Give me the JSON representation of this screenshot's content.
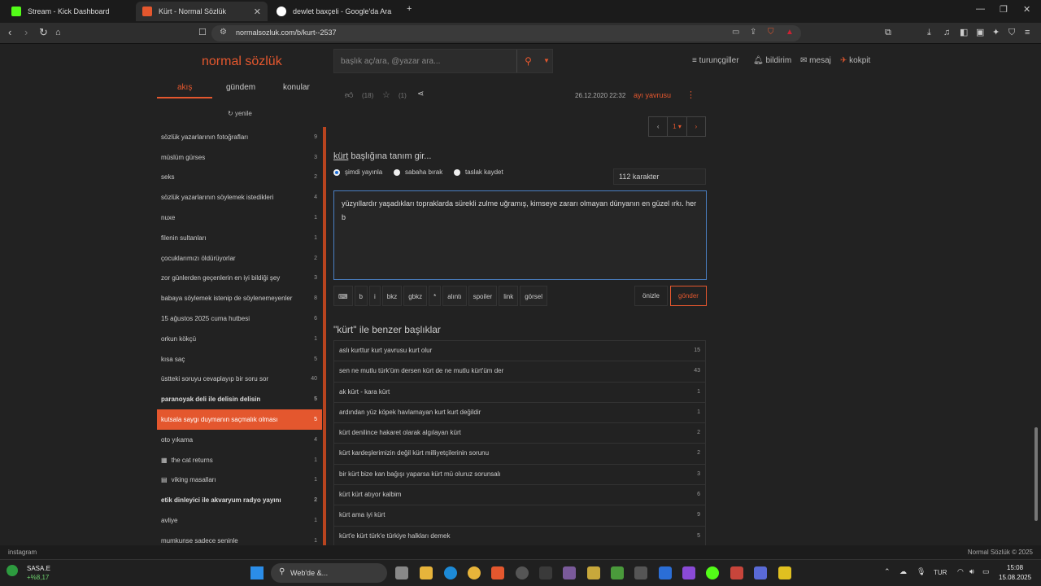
{
  "browser": {
    "tabs": [
      {
        "title": "Stream - Kick Dashboard",
        "color": "#53fc18"
      },
      {
        "title": "Kürt - Normal Sözlük",
        "color": "#e4572e"
      },
      {
        "title": "dewlet baxçeli - Google'da Ara",
        "color": "#ffffff"
      }
    ],
    "url": "normalsozluk.com/b/kurt--2537"
  },
  "site": {
    "logo": "normal sözlük",
    "search_placeholder": "başlık aç/ara, @yazar ara...",
    "nav": {
      "turuncgiller": "turunçgiller",
      "bildirim": "bildirim",
      "mesaj": "mesaj",
      "kokpit": "kokpit"
    },
    "left_tabs": [
      "akış",
      "gündem",
      "konular"
    ],
    "yenile": "yenile"
  },
  "left_list": [
    {
      "title": "sözlük yazarlarının fotoğrafları",
      "count": "9"
    },
    {
      "title": "müslüm gürses",
      "count": "3"
    },
    {
      "title": "seks",
      "count": "2"
    },
    {
      "title": "sözlük yazarlarının söylemek istedikleri",
      "count": "4"
    },
    {
      "title": "nuxe",
      "count": "1"
    },
    {
      "title": "filenin sultanları",
      "count": "1"
    },
    {
      "title": "çocuklarımızı öldürüyorlar",
      "count": "2"
    },
    {
      "title": "zor günlerden geçenlerin en iyi bildiği şey",
      "count": "3"
    },
    {
      "title": "babaya söylemek istenip de söylenemeyenler",
      "count": "8"
    },
    {
      "title": "15 ağustos 2025 cuma hutbesi",
      "count": "6"
    },
    {
      "title": "orkun kökçü",
      "count": "1"
    },
    {
      "title": "kısa saç",
      "count": "5"
    },
    {
      "title": "üstteki soruyu cevaplayıp bir soru sor",
      "count": "40"
    },
    {
      "title": "paranoyak deli ile delisin delisin",
      "count": "5"
    },
    {
      "title": "kutsala saygı duymanın saçmalık olması",
      "count": "5"
    },
    {
      "title": "oto yıkama",
      "count": "4"
    },
    {
      "title": "the cat returns",
      "count": "1"
    },
    {
      "title": "viking masalları",
      "count": "1"
    },
    {
      "title": "etik dinleyici ile akvaryum radyo yayını",
      "count": "2"
    },
    {
      "title": "avliye",
      "count": "1"
    },
    {
      "title": "mumkunse sadece seninle",
      "count": "1"
    }
  ],
  "entry": {
    "likes": "(18)",
    "favs": "(1)",
    "date": "26.12.2020 22:32",
    "author": "ayı yavrusu"
  },
  "pager": {
    "page": "1"
  },
  "form": {
    "topic": "kürt",
    "heading_rest": " başlığına tanım gir...",
    "options": [
      "şimdi yayınla",
      "sabaha bırak",
      "taslak kaydet"
    ],
    "char_count": "112 karakter",
    "text": "yüzyıllardır yaşadıkları topraklarda sürekli zulme uğramış, kimseye zararı olmayan dünyanın en güzel ırkı. her b",
    "tools": [
      "⌨",
      "b",
      "i",
      "bkz",
      "gbkz",
      "*",
      "alıntı",
      "spoiler",
      "link",
      "görsel"
    ],
    "preview": "önizle",
    "send": "gönder"
  },
  "similar": {
    "title": "\"kürt\" ile benzer başlıklar",
    "items": [
      {
        "title": "aslı kurttur kurt yavrusu kurt olur",
        "count": "15"
      },
      {
        "title": "sen ne mutlu türk'üm dersen kürt de ne mutlu kürt'üm der",
        "count": "43"
      },
      {
        "title": "ak kürt - kara kürt",
        "count": "1"
      },
      {
        "title": "ardından yüz köpek havlamayan kurt kurt değildir",
        "count": "1"
      },
      {
        "title": "kürt denilince hakaret olarak algılayan kürt",
        "count": "2"
      },
      {
        "title": "kürt kardeşlerimizin değil kürt milliyetçilerinin sorunu",
        "count": "2"
      },
      {
        "title": "bir kürt bize kan bağışı yaparsa kürt mü oluruz sorunsalı",
        "count": "3"
      },
      {
        "title": "kürt kürt atıyor kalbim",
        "count": "6"
      },
      {
        "title": "kürt ama iyi kürt",
        "count": "9"
      },
      {
        "title": "kürt'e kürt türk'e türkiye halkları demek",
        "count": "5"
      }
    ]
  },
  "status": {
    "left": "instagram",
    "right": "Normal Sözlük © 2025"
  },
  "taskbar": {
    "stock": "SASA.E",
    "stock_change": "+%8,17",
    "search": "Web'de &...",
    "lang": "TUR",
    "time": "15:08",
    "date": "15.08.2025"
  }
}
